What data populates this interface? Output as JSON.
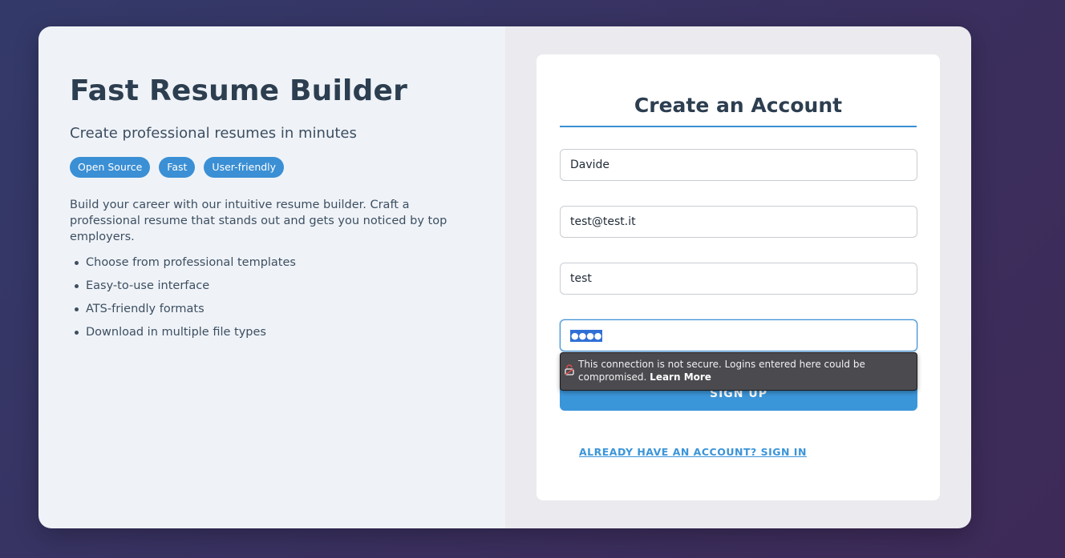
{
  "brand": {
    "title": "Fast Resume Builder",
    "subtitle": "Create professional resumes in minutes",
    "tags": [
      "Open Source",
      "Fast",
      "User-friendly"
    ],
    "description": "Build your career with our intuitive resume builder. Craft a professional resume that stands out and gets you noticed by top employers.",
    "features": [
      "Choose from professional templates",
      "Easy-to-use interface",
      "ATS-friendly formats",
      "Download in multiple file types"
    ]
  },
  "form": {
    "title": "Create an Account",
    "name_value": "Davide",
    "email_value": "test@test.it",
    "username_value": "test",
    "password_mask": "●●●●",
    "signup_label": "SIGN UP",
    "signin_link": "ALREADY HAVE AN ACCOUNT? SIGN IN"
  },
  "security_warning": {
    "icon": "insecure-lock-icon",
    "text": "This connection is not secure. Logins entered here could be compromised.",
    "link": "Learn More"
  },
  "colors": {
    "accent": "#3b8fd4",
    "heading": "#2c3e50",
    "warning_bg": "#4a4a4f"
  }
}
